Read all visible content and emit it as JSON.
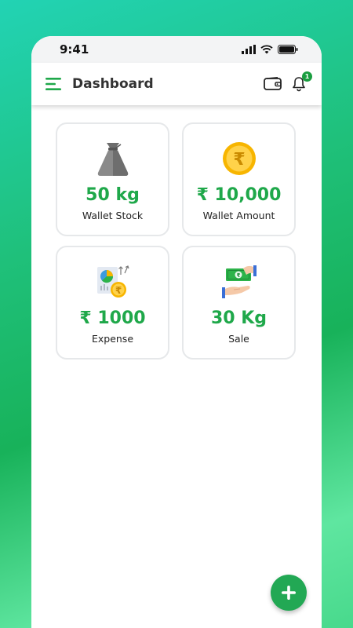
{
  "status_bar": {
    "time": "9:41"
  },
  "app_bar": {
    "title": "Dashboard",
    "notification_count": "1"
  },
  "cards": [
    {
      "value": "50 kg",
      "label": "Wallet Stock",
      "icon": "money-bag-icon"
    },
    {
      "value": "₹ 10,000",
      "label": "Wallet Amount",
      "icon": "rupee-coin-icon"
    },
    {
      "value": "₹ 1000",
      "label": "Expense",
      "icon": "expense-report-icon"
    },
    {
      "value": "30 Kg",
      "label": "Sale",
      "icon": "cash-hand-icon"
    }
  ],
  "colors": {
    "accent": "#1fa84a",
    "fab": "#22a854"
  }
}
